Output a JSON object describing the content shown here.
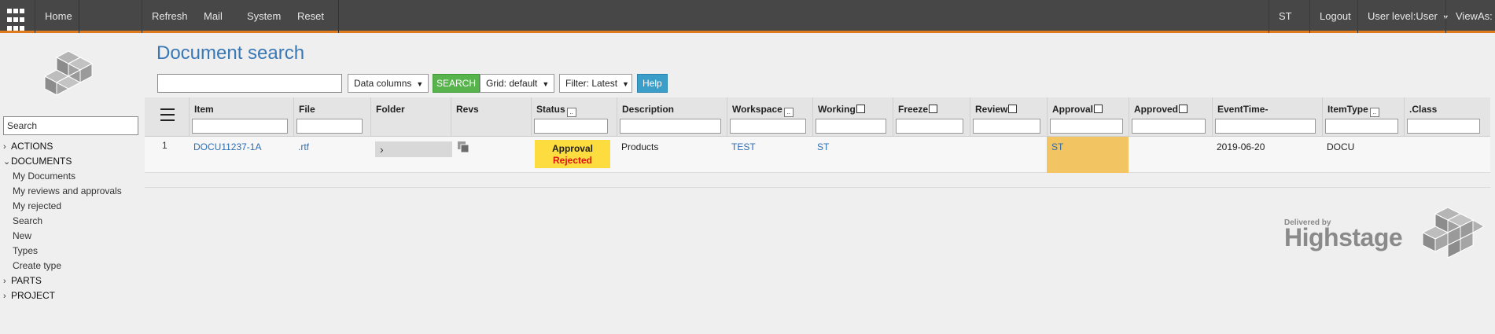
{
  "topbar": {
    "home": "Home",
    "refresh": "Refresh",
    "mail": "Mail",
    "system": "System",
    "reset": "Reset",
    "user_initials": "ST",
    "logout": "Logout",
    "user_level": "User level:User",
    "view_as": "ViewAs:"
  },
  "sidebar": {
    "search_placeholder": "Search",
    "sections": [
      {
        "label": "ACTIONS",
        "expanded": false
      },
      {
        "label": "DOCUMENTS",
        "expanded": true,
        "items": [
          "My Documents",
          "My reviews and approvals",
          "My rejected",
          "Search",
          "New",
          "Types",
          "Create type"
        ]
      },
      {
        "label": "PARTS",
        "expanded": false
      },
      {
        "label": "PROJECT",
        "expanded": false
      }
    ]
  },
  "main": {
    "title": "Document search",
    "toolbar": {
      "data_columns": "Data columns",
      "search": "SEARCH",
      "grid": "Grid: default",
      "filter": "Filter: Latest",
      "help": "Help"
    },
    "columns": [
      {
        "key": "item",
        "label": "Item"
      },
      {
        "key": "file",
        "label": "File"
      },
      {
        "key": "folder",
        "label": "Folder"
      },
      {
        "key": "revs",
        "label": "Revs"
      },
      {
        "key": "status",
        "label": "Status"
      },
      {
        "key": "description",
        "label": "Description"
      },
      {
        "key": "workspace",
        "label": "Workspace"
      },
      {
        "key": "working",
        "label": "Working"
      },
      {
        "key": "freeze",
        "label": "Freeze"
      },
      {
        "key": "review",
        "label": "Review"
      },
      {
        "key": "approval",
        "label": "Approval"
      },
      {
        "key": "approved",
        "label": "Approved"
      },
      {
        "key": "eventtime",
        "label": "EventTime-"
      },
      {
        "key": "itemtype",
        "label": "ItemType"
      },
      {
        "key": "class",
        "label": ".Class"
      }
    ],
    "rows": [
      {
        "num": "1",
        "item": "DOCU11237-1A",
        "file": ".rtf",
        "status_line1": "Approval",
        "status_line2": "Rejected",
        "description": "Products",
        "workspace": "TEST",
        "working": "ST",
        "approval": "ST",
        "eventtime": "2019-06-20",
        "itemtype": "DOCU"
      }
    ]
  },
  "brand": {
    "delivered_by": "Delivered by",
    "name": "Highstage"
  },
  "colors": {
    "topbar": "#474747",
    "accent": "#e07a1e",
    "title": "#3a78b5",
    "search_button": "#57b44d",
    "help_button": "#3b9ec9",
    "status_badge": "#fcdc3e",
    "rejected_text": "#dd1111",
    "approval_cell": "#f2c462"
  }
}
